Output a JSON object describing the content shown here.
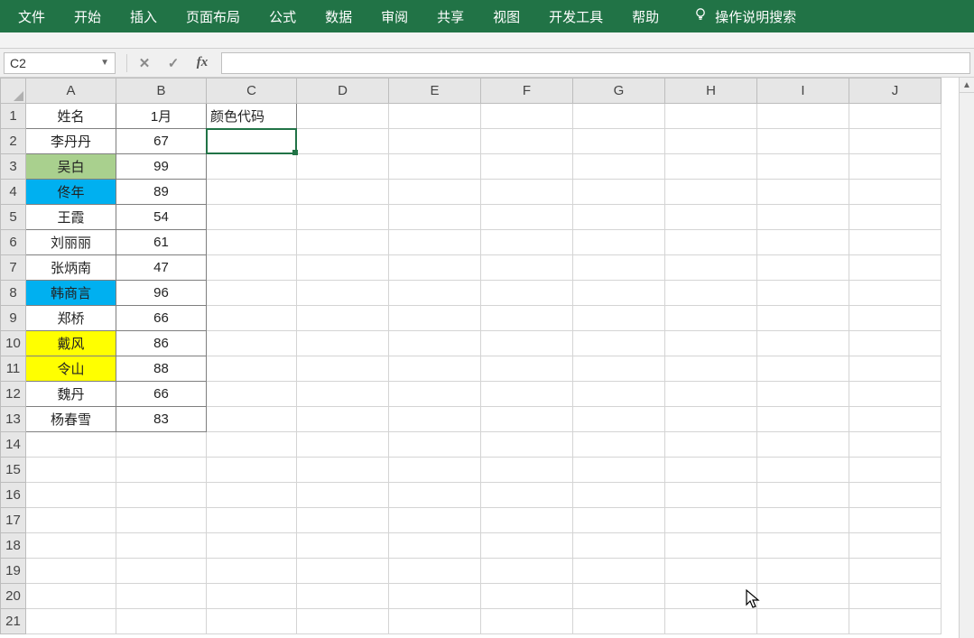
{
  "menu": {
    "items": [
      "文件",
      "开始",
      "插入",
      "页面布局",
      "公式",
      "数据",
      "审阅",
      "共享",
      "视图",
      "开发工具",
      "帮助"
    ],
    "search_hint": "操作说明搜索"
  },
  "formula_bar": {
    "name_box": "C2",
    "fx_label": "fx",
    "formula": ""
  },
  "columns": [
    "A",
    "B",
    "C",
    "D",
    "E",
    "F",
    "G",
    "H",
    "I",
    "J"
  ],
  "sheet": {
    "headers": {
      "A1": "姓名",
      "B1": "1月",
      "C1": "颜色代码"
    },
    "rows": [
      {
        "name": "李丹丹",
        "val": 67,
        "fill": null
      },
      {
        "name": "吴白",
        "val": 99,
        "fill": "green"
      },
      {
        "name": "佟年",
        "val": 89,
        "fill": "blue"
      },
      {
        "name": "王霞",
        "val": 54,
        "fill": null
      },
      {
        "name": "刘丽丽",
        "val": 61,
        "fill": null
      },
      {
        "name": "张炳南",
        "val": 47,
        "fill": null
      },
      {
        "name": "韩商言",
        "val": 96,
        "fill": "blue"
      },
      {
        "name": "郑桥",
        "val": 66,
        "fill": null
      },
      {
        "name": "戴风",
        "val": 86,
        "fill": "yellow"
      },
      {
        "name": "令山",
        "val": 88,
        "fill": "yellow"
      },
      {
        "name": "魏丹",
        "val": 66,
        "fill": null
      },
      {
        "name": "杨春雪",
        "val": 83,
        "fill": null
      }
    ]
  },
  "active_cell": "C2",
  "total_visible_rows": 21
}
